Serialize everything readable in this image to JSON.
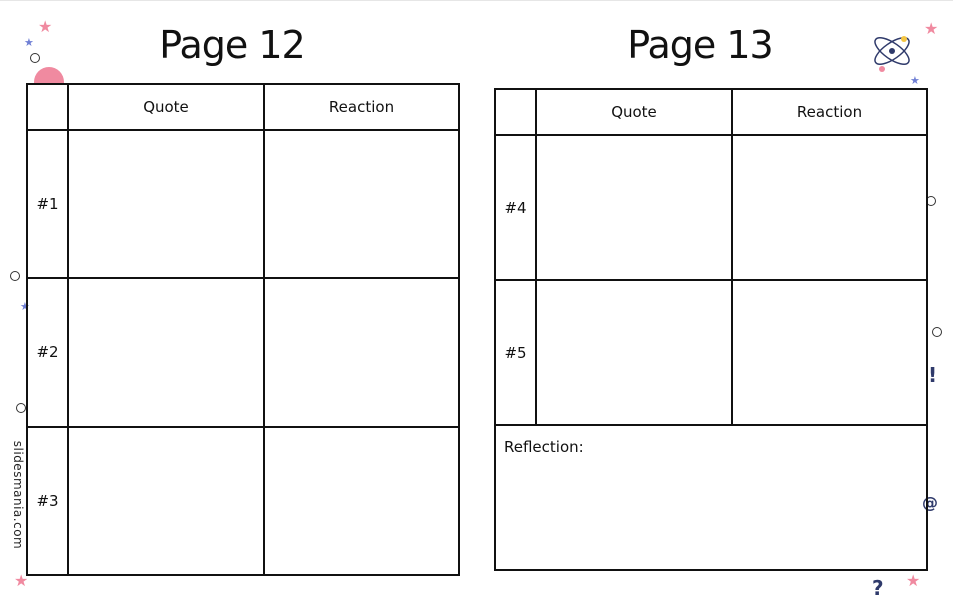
{
  "left_page": {
    "title": "Page 12",
    "columns": [
      "",
      "Quote",
      "Reaction"
    ],
    "rows": [
      "#1",
      "#2",
      "#3"
    ]
  },
  "right_page": {
    "title": "Page 13",
    "columns": [
      "",
      "Quote",
      "Reaction"
    ],
    "rows": [
      "#4",
      "#5"
    ],
    "reflection_label": "Reflection:"
  },
  "watermark": "slidesmania.com",
  "decorations": {
    "star_icon": "star-icon",
    "atom_icon": "atom-icon",
    "question_icon": "question-mark-icon",
    "exclamation_icon": "exclamation-icon",
    "at_icon": "at-sign-icon",
    "pink": "#f08aa0",
    "blue": "#6f7fd4",
    "navy": "#2f3a6b"
  }
}
